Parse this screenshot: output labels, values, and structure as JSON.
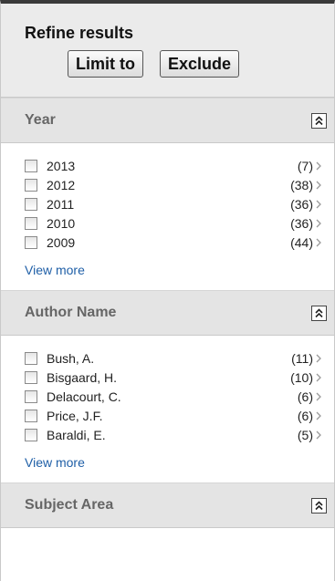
{
  "refine": {
    "title": "Refine results",
    "limit_label": "Limit to",
    "exclude_label": "Exclude"
  },
  "sections": [
    {
      "title": "Year",
      "collapse_icon": "double-chevron-up-icon",
      "items": [
        {
          "label": "2013",
          "count": "(7)"
        },
        {
          "label": "2012",
          "count": "(38)"
        },
        {
          "label": "2011",
          "count": "(36)"
        },
        {
          "label": "2010",
          "count": "(36)"
        },
        {
          "label": "2009",
          "count": "(44)"
        }
      ],
      "view_more": "View more"
    },
    {
      "title": "Author Name",
      "collapse_icon": "double-chevron-up-icon",
      "items": [
        {
          "label": "Bush, A.",
          "count": "(11)"
        },
        {
          "label": "Bisgaard, H.",
          "count": "(10)"
        },
        {
          "label": "Delacourt, C.",
          "count": "(6)"
        },
        {
          "label": "Price, J.F.",
          "count": "(6)"
        },
        {
          "label": "Baraldi, E.",
          "count": "(5)"
        }
      ],
      "view_more": "View more"
    },
    {
      "title": "Subject Area",
      "collapse_icon": "double-chevron-up-icon"
    }
  ],
  "colors": {
    "link": "#1f5fa7",
    "header_bg": "#e4e4e4",
    "refine_bg": "#ebebeb"
  }
}
